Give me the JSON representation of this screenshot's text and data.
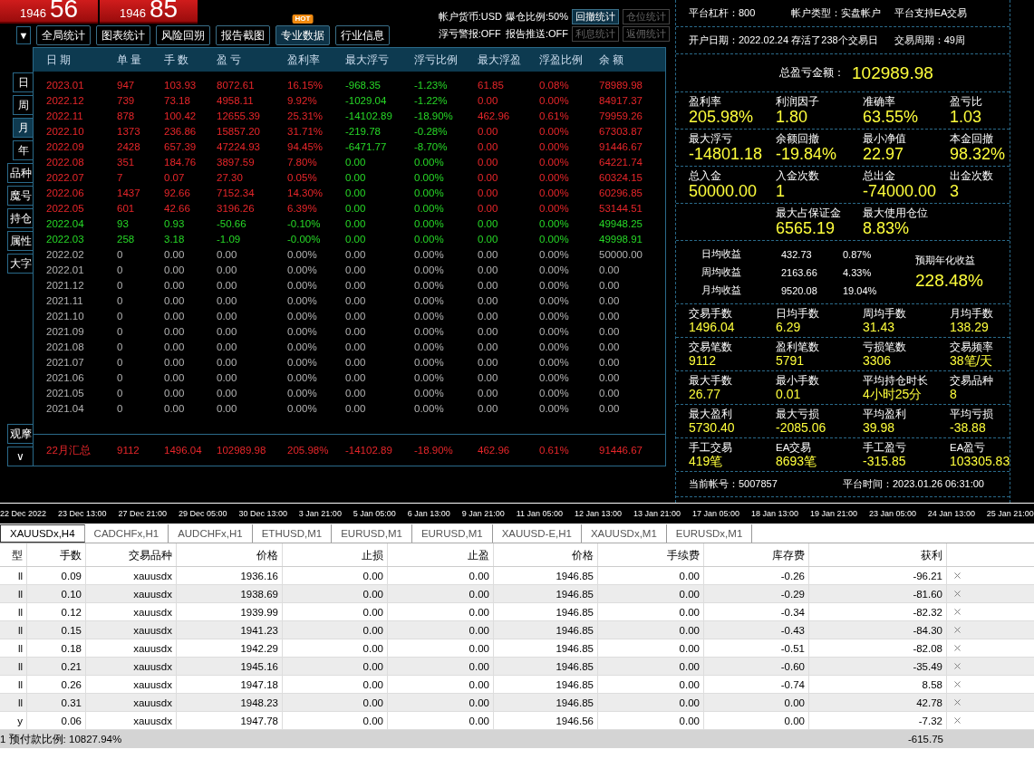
{
  "quotes": [
    {
      "big": "56",
      "small": "1946"
    },
    {
      "big": "85",
      "small": "1946"
    }
  ],
  "menu_caret": "▼",
  "toolbar": {
    "buttons": [
      {
        "label": "全局统计",
        "selected": false
      },
      {
        "label": "图表统计",
        "selected": false
      },
      {
        "label": "风险回朔",
        "selected": false
      },
      {
        "label": "报告截图",
        "selected": false
      },
      {
        "label": "专业数据",
        "selected": true,
        "badge": "HOT"
      },
      {
        "label": "行业信息",
        "selected": false
      }
    ],
    "settings": [
      [
        "帐户货币:USD",
        "爆仓比例:50%"
      ],
      [
        "浮亏警报:OFF",
        "报告推送:OFF"
      ]
    ],
    "stat_buttons": [
      {
        "label": "回撤统计",
        "disabled": false
      },
      {
        "label": "仓位统计",
        "disabled": true
      },
      {
        "label": "利息统计",
        "disabled": true
      },
      {
        "label": "返佣统计",
        "disabled": true
      }
    ]
  },
  "period_tabs": [
    {
      "label": "日",
      "selected": false
    },
    {
      "label": "周",
      "selected": false
    },
    {
      "label": "月",
      "selected": true
    },
    {
      "label": "年",
      "selected": false
    }
  ],
  "side_buttons": [
    "品种",
    "魔号",
    "持仓",
    "属性",
    "大字"
  ],
  "watch_button": "观摩",
  "expand_button": "∨",
  "table": {
    "columns": [
      {
        "label": "日 期",
        "kind": "plain"
      },
      {
        "label": "单 量",
        "kind": "plain"
      },
      {
        "label": "手 数",
        "kind": "plain"
      },
      {
        "label": "盈 亏",
        "kind": "plain"
      },
      {
        "label": "盈利率",
        "kind": "plain"
      },
      {
        "label": "最大浮亏",
        "kind": "drawdown"
      },
      {
        "label": "浮亏比例",
        "kind": "drawdown"
      },
      {
        "label": "最大浮盈",
        "kind": "plain"
      },
      {
        "label": "浮盈比例",
        "kind": "plain"
      },
      {
        "label": "余 额",
        "kind": "plain"
      }
    ],
    "rows": [
      {
        "kind": "gain",
        "cells": [
          "2023.01",
          "947",
          "103.93",
          "8072.61",
          "16.15%",
          "-968.35",
          "-1.23%",
          "61.85",
          "0.08%",
          "78989.98"
        ]
      },
      {
        "kind": "gain",
        "cells": [
          "2022.12",
          "739",
          "73.18",
          "4958.11",
          "9.92%",
          "-1029.04",
          "-1.22%",
          "0.00",
          "0.00%",
          "84917.37"
        ]
      },
      {
        "kind": "gain",
        "cells": [
          "2022.11",
          "878",
          "100.42",
          "12655.39",
          "25.31%",
          "-14102.89",
          "-18.90%",
          "462.96",
          "0.61%",
          "79959.26"
        ]
      },
      {
        "kind": "gain",
        "cells": [
          "2022.10",
          "1373",
          "236.86",
          "15857.20",
          "31.71%",
          "-219.78",
          "-0.28%",
          "0.00",
          "0.00%",
          "67303.87"
        ]
      },
      {
        "kind": "gain",
        "cells": [
          "2022.09",
          "2428",
          "657.39",
          "47224.93",
          "94.45%",
          "-6471.77",
          "-8.70%",
          "0.00",
          "0.00%",
          "91446.67"
        ]
      },
      {
        "kind": "gain",
        "cells": [
          "2022.08",
          "351",
          "184.76",
          "3897.59",
          "7.80%",
          "0.00",
          "0.00%",
          "0.00",
          "0.00%",
          "64221.74"
        ]
      },
      {
        "kind": "gain",
        "cells": [
          "2022.07",
          "7",
          "0.07",
          "27.30",
          "0.05%",
          "0.00",
          "0.00%",
          "0.00",
          "0.00%",
          "60324.15"
        ]
      },
      {
        "kind": "gain",
        "cells": [
          "2022.06",
          "1437",
          "92.66",
          "7152.34",
          "14.30%",
          "0.00",
          "0.00%",
          "0.00",
          "0.00%",
          "60296.85"
        ]
      },
      {
        "kind": "gain",
        "cells": [
          "2022.05",
          "601",
          "42.66",
          "3196.26",
          "6.39%",
          "0.00",
          "0.00%",
          "0.00",
          "0.00%",
          "53144.51"
        ]
      },
      {
        "kind": "loss",
        "cells": [
          "2022.04",
          "93",
          "0.93",
          "-50.66",
          "-0.10%",
          "0.00",
          "0.00%",
          "0.00",
          "0.00%",
          "49948.25"
        ]
      },
      {
        "kind": "loss",
        "cells": [
          "2022.03",
          "258",
          "3.18",
          "-1.09",
          "-0.00%",
          "0.00",
          "0.00%",
          "0.00",
          "0.00%",
          "49998.91"
        ]
      },
      {
        "kind": "flat",
        "cells": [
          "2022.02",
          "0",
          "0.00",
          "0.00",
          "0.00%",
          "0.00",
          "0.00%",
          "0.00",
          "0.00%",
          "50000.00"
        ]
      },
      {
        "kind": "flat",
        "cells": [
          "2022.01",
          "0",
          "0.00",
          "0.00",
          "0.00%",
          "0.00",
          "0.00%",
          "0.00",
          "0.00%",
          "0.00"
        ]
      },
      {
        "kind": "flat",
        "cells": [
          "2021.12",
          "0",
          "0.00",
          "0.00",
          "0.00%",
          "0.00",
          "0.00%",
          "0.00",
          "0.00%",
          "0.00"
        ]
      },
      {
        "kind": "flat",
        "cells": [
          "2021.11",
          "0",
          "0.00",
          "0.00",
          "0.00%",
          "0.00",
          "0.00%",
          "0.00",
          "0.00%",
          "0.00"
        ]
      },
      {
        "kind": "flat",
        "cells": [
          "2021.10",
          "0",
          "0.00",
          "0.00",
          "0.00%",
          "0.00",
          "0.00%",
          "0.00",
          "0.00%",
          "0.00"
        ]
      },
      {
        "kind": "flat",
        "cells": [
          "2021.09",
          "0",
          "0.00",
          "0.00",
          "0.00%",
          "0.00",
          "0.00%",
          "0.00",
          "0.00%",
          "0.00"
        ]
      },
      {
        "kind": "flat",
        "cells": [
          "2021.08",
          "0",
          "0.00",
          "0.00",
          "0.00%",
          "0.00",
          "0.00%",
          "0.00",
          "0.00%",
          "0.00"
        ]
      },
      {
        "kind": "flat",
        "cells": [
          "2021.07",
          "0",
          "0.00",
          "0.00",
          "0.00%",
          "0.00",
          "0.00%",
          "0.00",
          "0.00%",
          "0.00"
        ]
      },
      {
        "kind": "flat",
        "cells": [
          "2021.06",
          "0",
          "0.00",
          "0.00",
          "0.00%",
          "0.00",
          "0.00%",
          "0.00",
          "0.00%",
          "0.00"
        ]
      },
      {
        "kind": "flat",
        "cells": [
          "2021.05",
          "0",
          "0.00",
          "0.00",
          "0.00%",
          "0.00",
          "0.00%",
          "0.00",
          "0.00%",
          "0.00"
        ]
      },
      {
        "kind": "flat",
        "cells": [
          "2021.04",
          "0",
          "0.00",
          "0.00",
          "0.00%",
          "0.00",
          "0.00%",
          "0.00",
          "0.00%",
          "0.00"
        ]
      }
    ],
    "summary": [
      "22月汇总",
      "9112",
      "1496.04",
      "102989.98",
      "205.98%",
      "-14102.89",
      "-18.90%",
      "462.96",
      "0.61%",
      "91446.67"
    ]
  },
  "panel": [
    {
      "kind": "info",
      "items": [
        "平台杠杆：800",
        "帐户类型：实盘帐户",
        "平台支持EA交易"
      ]
    },
    {
      "kind": "info",
      "items": [
        "开户日期：2022.02.24",
        "存活了238个交易日",
        "交易周期：49周"
      ]
    },
    {
      "kind": "total",
      "label": "总盈亏金额：",
      "value": "102989.98"
    },
    {
      "kind": "stats",
      "items": [
        {
          "label": "盈利率",
          "value": "205.98%"
        },
        {
          "label": "利润因子",
          "value": "1.80"
        },
        {
          "label": "准确率",
          "value": "63.55%"
        },
        {
          "label": "盈亏比",
          "value": "1.03"
        }
      ]
    },
    {
      "kind": "stats",
      "items": [
        {
          "label": "最大浮亏",
          "value": "-14801.18"
        },
        {
          "label": "余额回撤",
          "value": "-19.84%"
        },
        {
          "label": "最小净值",
          "value": "22.97"
        },
        {
          "label": "本金回撤",
          "value": "98.32%"
        }
      ]
    },
    {
      "kind": "stats",
      "items": [
        {
          "label": "总入金",
          "value": "50000.00"
        },
        {
          "label": "入金次数",
          "value": "1"
        },
        {
          "label": "总出金",
          "value": "-74000.00"
        },
        {
          "label": "出金次数",
          "value": "3"
        }
      ]
    },
    {
      "kind": "pair",
      "items": [
        {
          "label": "最大占保证金",
          "value": "6565.19"
        },
        {
          "label": "最大使用仓位",
          "value": "8.83%"
        }
      ]
    },
    {
      "kind": "earnings",
      "rows": [
        {
          "label": "日均收益",
          "amount": "432.73",
          "percent": "0.87%"
        },
        {
          "label": "周均收益",
          "amount": "2163.66",
          "percent": "4.33%"
        },
        {
          "label": "月均收益",
          "amount": "9520.08",
          "percent": "19.04%"
        }
      ],
      "annual": {
        "label": "预期年化收益",
        "value": "228.48%"
      }
    },
    {
      "kind": "small",
      "items": [
        {
          "label": "交易手数",
          "value": "1496.04"
        },
        {
          "label": "日均手数",
          "value": "6.29"
        },
        {
          "label": "周均手数",
          "value": "31.43"
        },
        {
          "label": "月均手数",
          "value": "138.29"
        }
      ]
    },
    {
      "kind": "small",
      "items": [
        {
          "label": "交易笔数",
          "value": "9112"
        },
        {
          "label": "盈利笔数",
          "value": "5791"
        },
        {
          "label": "亏损笔数",
          "value": "3306"
        },
        {
          "label": "交易频率",
          "value": "38笔/天"
        }
      ]
    },
    {
      "kind": "small",
      "items": [
        {
          "label": "最大手数",
          "value": "26.77"
        },
        {
          "label": "最小手数",
          "value": "0.01"
        },
        {
          "label": "平均持仓时长",
          "value": "4小时25分"
        },
        {
          "label": "交易品种",
          "value": "8"
        }
      ]
    },
    {
      "kind": "small",
      "items": [
        {
          "label": "最大盈利",
          "value": "5730.40"
        },
        {
          "label": "最大亏损",
          "value": "-2085.06"
        },
        {
          "label": "平均盈利",
          "value": "39.98"
        },
        {
          "label": "平均亏损",
          "value": "-38.88"
        }
      ]
    },
    {
      "kind": "small",
      "items": [
        {
          "label": "手工交易",
          "value": "419笔"
        },
        {
          "label": "EA交易",
          "value": "8693笔"
        },
        {
          "label": "手工盈亏",
          "value": "-315.85"
        },
        {
          "label": "EA盈亏",
          "value": "103305.83"
        }
      ]
    },
    {
      "kind": "footer",
      "items": [
        "当前帐号：5007857",
        "平台时间：2023.01.26 06:31:00"
      ]
    }
  ],
  "time_axis": [
    "22 Dec 2022",
    "23 Dec 13:00",
    "27 Dec 21:00",
    "29 Dec 05:00",
    "30 Dec 13:00",
    "3 Jan 21:00",
    "5 Jan 05:00",
    "6 Jan 13:00",
    "9 Jan 21:00",
    "11 Jan 05:00",
    "12 Jan 13:00",
    "13 Jan 21:00",
    "17 Jan 05:00",
    "18 Jan 13:00",
    "19 Jan 21:00",
    "23 Jan 05:00",
    "24 Jan 13:00",
    "25 Jan 21:00"
  ],
  "chart_tabs": [
    {
      "label": "XAUUSDx,H4",
      "selected": true
    },
    {
      "label": "CADCHFx,H1",
      "selected": false
    },
    {
      "label": "AUDCHFx,H1",
      "selected": false
    },
    {
      "label": "ETHUSD,M1",
      "selected": false
    },
    {
      "label": "EURUSD,M1",
      "selected": false
    },
    {
      "label": "EURUSD,M1",
      "selected": false
    },
    {
      "label": "XAUUSD-E,H1",
      "selected": false
    },
    {
      "label": "XAUUSDx,M1",
      "selected": false
    },
    {
      "label": "EURUSDx,M1",
      "selected": false
    }
  ],
  "orders": {
    "columns": [
      "型",
      "手数",
      "交易品种",
      "价格",
      "止损",
      "止盈",
      "价格",
      "手续费",
      "库存费",
      "获利"
    ],
    "rows": [
      [
        "ll",
        "0.09",
        "xauusdx",
        "1936.16",
        "0.00",
        "0.00",
        "1946.85",
        "0.00",
        "-0.26",
        "-96.21"
      ],
      [
        "ll",
        "0.10",
        "xauusdx",
        "1938.69",
        "0.00",
        "0.00",
        "1946.85",
        "0.00",
        "-0.29",
        "-81.60"
      ],
      [
        "ll",
        "0.12",
        "xauusdx",
        "1939.99",
        "0.00",
        "0.00",
        "1946.85",
        "0.00",
        "-0.34",
        "-82.32"
      ],
      [
        "ll",
        "0.15",
        "xauusdx",
        "1941.23",
        "0.00",
        "0.00",
        "1946.85",
        "0.00",
        "-0.43",
        "-84.30"
      ],
      [
        "ll",
        "0.18",
        "xauusdx",
        "1942.29",
        "0.00",
        "0.00",
        "1946.85",
        "0.00",
        "-0.51",
        "-82.08"
      ],
      [
        "ll",
        "0.21",
        "xauusdx",
        "1945.16",
        "0.00",
        "0.00",
        "1946.85",
        "0.00",
        "-0.60",
        "-35.49"
      ],
      [
        "ll",
        "0.26",
        "xauusdx",
        "1947.18",
        "0.00",
        "0.00",
        "1946.85",
        "0.00",
        "-0.74",
        "8.58"
      ],
      [
        "ll",
        "0.31",
        "xauusdx",
        "1948.23",
        "0.00",
        "0.00",
        "1946.85",
        "0.00",
        "0.00",
        "42.78"
      ],
      [
        "y",
        "0.06",
        "xauusdx",
        "1947.78",
        "0.00",
        "0.00",
        "1946.56",
        "0.00",
        "0.00",
        "-7.32"
      ]
    ],
    "status": {
      "left": "1  预付款比例: 10827.94%",
      "total": "-615.75"
    }
  }
}
